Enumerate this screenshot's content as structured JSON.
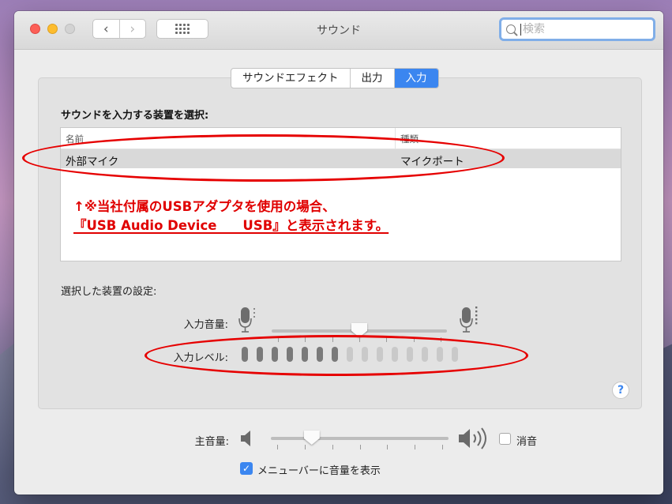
{
  "window": {
    "title": "サウンド"
  },
  "toolbar": {
    "back_icon": "‹",
    "forward_icon": "›",
    "search_placeholder": "検索"
  },
  "tabs": [
    {
      "label": "サウンドエフェクト",
      "active": false
    },
    {
      "label": "出力",
      "active": false
    },
    {
      "label": "入力",
      "active": true
    }
  ],
  "input_panel": {
    "heading": "サウンドを入力する装置を選択:",
    "columns": {
      "name": "名前",
      "type": "種類"
    },
    "rows": [
      {
        "name": "外部マイク",
        "type": "マイクポート",
        "selected": true
      }
    ],
    "annotation_line1": "↑※当社付属のUSBアダプタを使用の場合、",
    "annotation_line2": "『USB Audio Device　　USB』と表示されます。"
  },
  "device_settings": {
    "heading": "選択した装置の設定:",
    "input_volume_label": "入力音量:",
    "input_volume_value": 0.5,
    "input_level_label": "入力レベル:",
    "input_level_active": 7,
    "input_level_total": 15
  },
  "help": {
    "label": "?"
  },
  "footer": {
    "main_volume_label": "主音量:",
    "main_volume_value": 0.23,
    "mute_label": "消音",
    "mute_checked": false,
    "menu_checkbox_label": "メニューバーに音量を表示",
    "menu_checked": true,
    "check_glyph": "✓"
  },
  "colors": {
    "accent": "#3b86f0",
    "annotation": "#e00000"
  }
}
